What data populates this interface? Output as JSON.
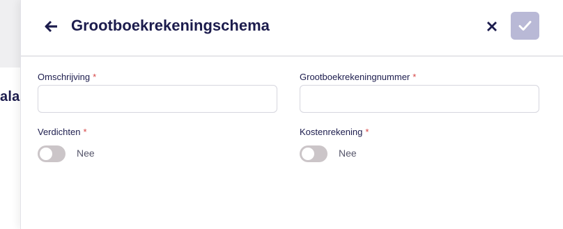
{
  "background": {
    "partial_text": "ala"
  },
  "drawer": {
    "title": "Grootboekrekeningschema",
    "back_icon": "arrow-left-icon",
    "close_icon": "close-icon",
    "confirm_icon": "check-icon",
    "confirm_color": "#b9b9d6",
    "text_color": "#1c1c4d",
    "required_color": "#d64545"
  },
  "form": {
    "description": {
      "label": "Omschrijving",
      "required": "*",
      "value": ""
    },
    "account_number": {
      "label": "Grootboekrekeningnummer",
      "required": "*",
      "value": ""
    },
    "condense": {
      "label": "Verdichten",
      "required": "*",
      "state": "Nee"
    },
    "cost_account": {
      "label": "Kostenrekening",
      "required": "*",
      "state": "Nee"
    }
  }
}
